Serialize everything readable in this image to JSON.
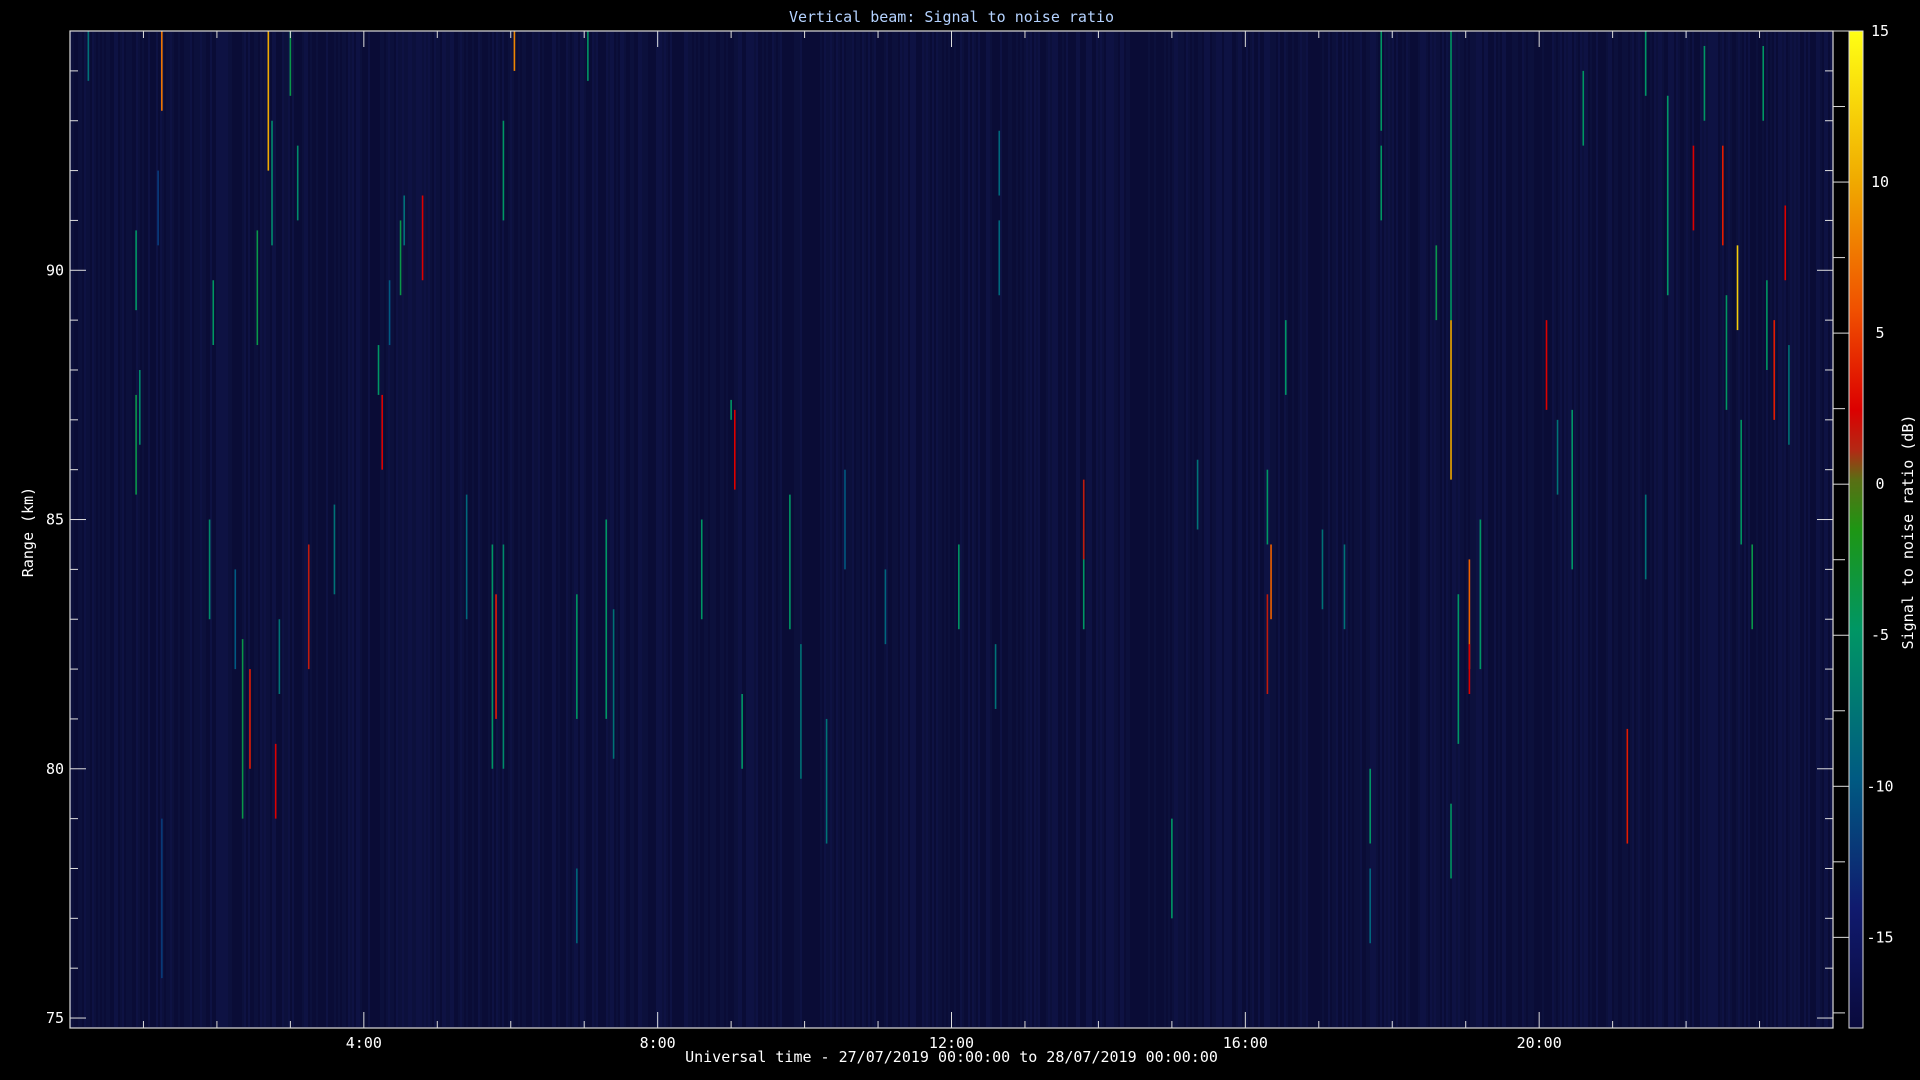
{
  "chart_data": {
    "type": "heatmap",
    "title": "Vertical beam: Signal to noise ratio",
    "xlabel": "Universal time - 27/07/2019 00:00:00 to 28/07/2019 00:00:00",
    "ylabel": "Range (km)",
    "colorbar_label": "Signal to noise ratio (dB)",
    "x_unit": "hours UT",
    "xlim": [
      0,
      24
    ],
    "ylim": [
      74.8,
      94.8
    ],
    "x_ticks": [
      4,
      8,
      12,
      16,
      20
    ],
    "x_tick_labels": [
      "4:00",
      "8:00",
      "12:00",
      "16:00",
      "20:00"
    ],
    "y_ticks": [
      75,
      80,
      85,
      90
    ],
    "y_tick_labels": [
      "75",
      "80",
      "85",
      "90"
    ],
    "colorbar_range": [
      -18,
      15
    ],
    "colorbar_ticks": [
      -15,
      -10,
      -5,
      0,
      5,
      10,
      15
    ],
    "colorbar_tick_labels": [
      "-15",
      "-10",
      "-5",
      "0",
      "5",
      "10",
      "15"
    ],
    "background_snr": -17,
    "echoes": [
      {
        "t": 0.25,
        "r0": 93.8,
        "r1": 94.8,
        "snr": -8
      },
      {
        "t": 0.9,
        "r0": 85.5,
        "r1": 87.5,
        "snr": -4
      },
      {
        "t": 0.95,
        "r0": 86.5,
        "r1": 88.0,
        "snr": -6
      },
      {
        "t": 0.9,
        "r0": 89.2,
        "r1": 90.8,
        "snr": -5
      },
      {
        "t": 1.25,
        "r0": 93.2,
        "r1": 94.8,
        "snr": 7
      },
      {
        "t": 1.25,
        "r0": 75.8,
        "r1": 79.0,
        "snr": -12
      },
      {
        "t": 1.2,
        "r0": 90.5,
        "r1": 92.0,
        "snr": -12
      },
      {
        "t": 1.95,
        "r0": 88.5,
        "r1": 89.8,
        "snr": -5
      },
      {
        "t": 1.9,
        "r0": 83.0,
        "r1": 85.0,
        "snr": -6
      },
      {
        "t": 2.35,
        "r0": 79.0,
        "r1": 82.6,
        "snr": -4
      },
      {
        "t": 2.45,
        "r0": 80.0,
        "r1": 82.0,
        "snr": 3
      },
      {
        "t": 2.25,
        "r0": 82.0,
        "r1": 84.0,
        "snr": -10
      },
      {
        "t": 2.55,
        "r0": 88.5,
        "r1": 90.8,
        "snr": -4
      },
      {
        "t": 2.7,
        "r0": 92.0,
        "r1": 94.8,
        "snr": 10
      },
      {
        "t": 2.75,
        "r0": 90.5,
        "r1": 93.0,
        "snr": -6
      },
      {
        "t": 2.8,
        "r0": 79.0,
        "r1": 80.5,
        "snr": 2
      },
      {
        "t": 2.85,
        "r0": 81.5,
        "r1": 83.0,
        "snr": -8
      },
      {
        "t": 3.0,
        "r0": 93.5,
        "r1": 94.8,
        "snr": -4
      },
      {
        "t": 3.1,
        "r0": 91.0,
        "r1": 92.5,
        "snr": -6
      },
      {
        "t": 3.25,
        "r0": 82.0,
        "r1": 84.5,
        "snr": 1
      },
      {
        "t": 3.6,
        "r0": 83.5,
        "r1": 85.3,
        "snr": -8
      },
      {
        "t": 4.25,
        "r0": 86.0,
        "r1": 87.5,
        "snr": 2
      },
      {
        "t": 4.2,
        "r0": 87.5,
        "r1": 88.5,
        "snr": -5
      },
      {
        "t": 4.35,
        "r0": 88.5,
        "r1": 89.8,
        "snr": -10
      },
      {
        "t": 4.5,
        "r0": 89.5,
        "r1": 91.0,
        "snr": -4
      },
      {
        "t": 4.55,
        "r0": 90.5,
        "r1": 91.5,
        "snr": -8
      },
      {
        "t": 4.8,
        "r0": 89.8,
        "r1": 91.5,
        "snr": 2
      },
      {
        "t": 5.4,
        "r0": 83.0,
        "r1": 85.5,
        "snr": -9
      },
      {
        "t": 5.75,
        "r0": 80.0,
        "r1": 84.5,
        "snr": -5
      },
      {
        "t": 5.8,
        "r0": 81.0,
        "r1": 83.5,
        "snr": 3
      },
      {
        "t": 5.9,
        "r0": 80.0,
        "r1": 84.5,
        "snr": -6
      },
      {
        "t": 5.9,
        "r0": 91.0,
        "r1": 93.0,
        "snr": -5
      },
      {
        "t": 6.05,
        "r0": 94.0,
        "r1": 94.8,
        "snr": 8
      },
      {
        "t": 6.9,
        "r0": 81.0,
        "r1": 83.5,
        "snr": -5
      },
      {
        "t": 7.05,
        "r0": 93.8,
        "r1": 94.8,
        "snr": -5
      },
      {
        "t": 6.9,
        "r0": 76.5,
        "r1": 78.0,
        "snr": -9
      },
      {
        "t": 7.3,
        "r0": 81.0,
        "r1": 85.0,
        "snr": -5
      },
      {
        "t": 7.4,
        "r0": 80.2,
        "r1": 83.2,
        "snr": -8
      },
      {
        "t": 8.6,
        "r0": 83.0,
        "r1": 85.0,
        "snr": -5
      },
      {
        "t": 9.05,
        "r0": 85.6,
        "r1": 87.2,
        "snr": 2
      },
      {
        "t": 9.0,
        "r0": 87.0,
        "r1": 87.4,
        "snr": -5
      },
      {
        "t": 9.15,
        "r0": 80.0,
        "r1": 81.5,
        "snr": -5
      },
      {
        "t": 9.8,
        "r0": 82.8,
        "r1": 85.5,
        "snr": -5
      },
      {
        "t": 9.95,
        "r0": 79.8,
        "r1": 82.5,
        "snr": -8
      },
      {
        "t": 10.3,
        "r0": 78.5,
        "r1": 81.0,
        "snr": -8
      },
      {
        "t": 10.55,
        "r0": 84.0,
        "r1": 86.0,
        "snr": -10
      },
      {
        "t": 11.1,
        "r0": 82.5,
        "r1": 84.0,
        "snr": -9
      },
      {
        "t": 12.1,
        "r0": 82.8,
        "r1": 84.5,
        "snr": -5
      },
      {
        "t": 12.6,
        "r0": 81.2,
        "r1": 82.5,
        "snr": -8
      },
      {
        "t": 12.65,
        "r0": 89.5,
        "r1": 91.0,
        "snr": -9
      },
      {
        "t": 12.65,
        "r0": 91.5,
        "r1": 92.8,
        "snr": -9
      },
      {
        "t": 13.8,
        "r0": 82.8,
        "r1": 84.8,
        "snr": -5
      },
      {
        "t": 13.8,
        "r0": 84.2,
        "r1": 85.8,
        "snr": 1
      },
      {
        "t": 15.0,
        "r0": 77.0,
        "r1": 79.0,
        "snr": -5
      },
      {
        "t": 15.35,
        "r0": 84.8,
        "r1": 86.2,
        "snr": -8
      },
      {
        "t": 16.3,
        "r0": 81.5,
        "r1": 83.5,
        "snr": 1
      },
      {
        "t": 16.35,
        "r0": 83.0,
        "r1": 84.5,
        "snr": 6
      },
      {
        "t": 16.3,
        "r0": 84.5,
        "r1": 86.0,
        "snr": -5
      },
      {
        "t": 16.55,
        "r0": 87.5,
        "r1": 89.0,
        "snr": -5
      },
      {
        "t": 17.05,
        "r0": 83.2,
        "r1": 84.8,
        "snr": -8
      },
      {
        "t": 17.35,
        "r0": 82.8,
        "r1": 84.5,
        "snr": -8
      },
      {
        "t": 17.7,
        "r0": 78.5,
        "r1": 80.0,
        "snr": -5
      },
      {
        "t": 17.7,
        "r0": 76.5,
        "r1": 78.0,
        "snr": -9
      },
      {
        "t": 17.85,
        "r0": 92.8,
        "r1": 94.8,
        "snr": -5
      },
      {
        "t": 17.85,
        "r0": 91.0,
        "r1": 92.5,
        "snr": -5
      },
      {
        "t": 18.6,
        "r0": 89.0,
        "r1": 90.5,
        "snr": -4
      },
      {
        "t": 18.8,
        "r0": 85.8,
        "r1": 89.0,
        "snr": 10
      },
      {
        "t": 18.8,
        "r0": 89.0,
        "r1": 94.8,
        "snr": -5
      },
      {
        "t": 18.9,
        "r0": 80.5,
        "r1": 83.5,
        "snr": -5
      },
      {
        "t": 18.8,
        "r0": 77.8,
        "r1": 79.3,
        "snr": -5
      },
      {
        "t": 19.05,
        "r0": 82.0,
        "r1": 84.2,
        "snr": 6
      },
      {
        "t": 19.05,
        "r0": 81.5,
        "r1": 82.5,
        "snr": 2
      },
      {
        "t": 19.2,
        "r0": 82.0,
        "r1": 85.0,
        "snr": -5
      },
      {
        "t": 20.1,
        "r0": 87.2,
        "r1": 89.0,
        "snr": 2
      },
      {
        "t": 20.25,
        "r0": 85.5,
        "r1": 87.0,
        "snr": -8
      },
      {
        "t": 20.45,
        "r0": 84.0,
        "r1": 87.2,
        "snr": -5
      },
      {
        "t": 20.6,
        "r0": 92.5,
        "r1": 94.0,
        "snr": -5
      },
      {
        "t": 21.2,
        "r0": 78.5,
        "r1": 80.8,
        "snr": 3
      },
      {
        "t": 21.45,
        "r0": 93.5,
        "r1": 94.8,
        "snr": -5
      },
      {
        "t": 21.45,
        "r0": 83.8,
        "r1": 85.5,
        "snr": -8
      },
      {
        "t": 21.75,
        "r0": 89.5,
        "r1": 93.5,
        "snr": -5
      },
      {
        "t": 22.1,
        "r0": 90.8,
        "r1": 92.5,
        "snr": 2
      },
      {
        "t": 22.25,
        "r0": 93.0,
        "r1": 94.5,
        "snr": -5
      },
      {
        "t": 22.5,
        "r0": 90.5,
        "r1": 92.5,
        "snr": 3
      },
      {
        "t": 22.55,
        "r0": 87.2,
        "r1": 89.5,
        "snr": -5
      },
      {
        "t": 22.7,
        "r0": 88.8,
        "r1": 90.5,
        "snr": 12
      },
      {
        "t": 22.75,
        "r0": 84.5,
        "r1": 87.0,
        "snr": -5
      },
      {
        "t": 22.9,
        "r0": 82.8,
        "r1": 84.5,
        "snr": -4
      },
      {
        "t": 23.05,
        "r0": 93.0,
        "r1": 94.5,
        "snr": -5
      },
      {
        "t": 23.1,
        "r0": 88.0,
        "r1": 89.8,
        "snr": -5
      },
      {
        "t": 23.2,
        "r0": 87.0,
        "r1": 89.0,
        "snr": 3
      },
      {
        "t": 23.35,
        "r0": 89.8,
        "r1": 91.3,
        "snr": 2
      },
      {
        "t": 23.4,
        "r0": 86.5,
        "r1": 88.5,
        "snr": -8
      }
    ]
  }
}
